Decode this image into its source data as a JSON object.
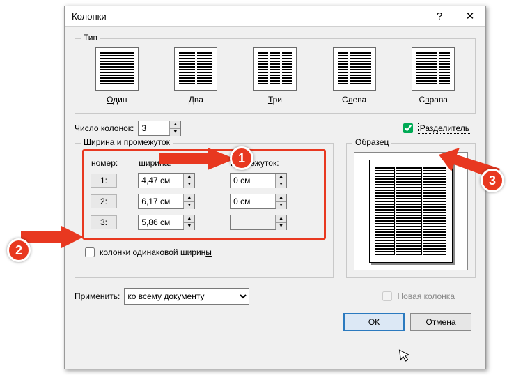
{
  "dialog": {
    "title": "Колонки",
    "help_icon": "?",
    "close_icon": "✕"
  },
  "presets_group": {
    "label": "Тип"
  },
  "presets": {
    "one": {
      "label": "Один",
      "accel": "О"
    },
    "two": {
      "label": "Два",
      "accel": "Д"
    },
    "three": {
      "label": "Три",
      "accel": "Т"
    },
    "left": {
      "label": "Слева",
      "accel": "л"
    },
    "right": {
      "label": "Справа",
      "accel": "п"
    }
  },
  "ncount": {
    "label": "Число колонок:",
    "value": "3"
  },
  "separator": {
    "label": "Разделитель",
    "checked": true
  },
  "width_group": {
    "label": "Ширина и промежуток"
  },
  "table": {
    "header_num": "номер:",
    "header_width": "ширина:",
    "header_gap": "промежуток:",
    "rows": [
      {
        "n": "1:",
        "width": "4,47 см",
        "gap": "0 см"
      },
      {
        "n": "2:",
        "width": "6,17 см",
        "gap": "0 см"
      },
      {
        "n": "3:",
        "width": "5,86 см",
        "gap": ""
      }
    ]
  },
  "equal_width": {
    "label": "колонки одинаковой ширины",
    "checked": false
  },
  "sample_group": {
    "label": "Образец"
  },
  "apply": {
    "label": "Применить:",
    "value": "ко всему документу"
  },
  "new_column": {
    "label": "Новая колонка",
    "enabled": false
  },
  "buttons": {
    "ok": "ОК",
    "cancel": "Отмена"
  },
  "callouts": {
    "c1": "1",
    "c2": "2",
    "c3": "3"
  }
}
